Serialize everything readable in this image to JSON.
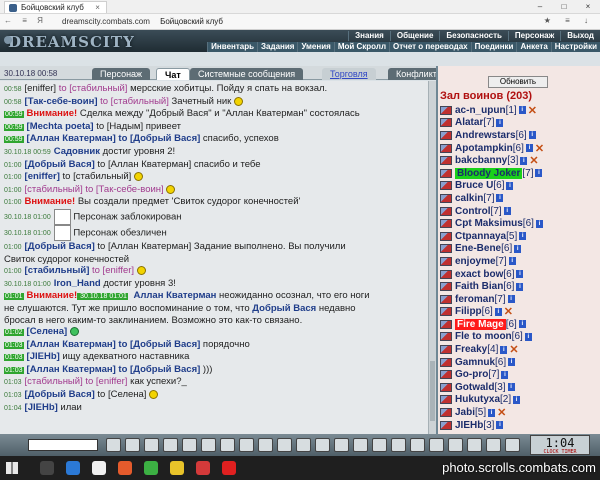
{
  "browser": {
    "tab_title": "Бойцовский клуб",
    "url": "dreamscity.combats.com",
    "page_title": "Бойцовский клуб",
    "nav_glyphs": "← ≡ Я",
    "tools_glyphs": "★ ≡ ↓"
  },
  "game": {
    "logo": "DREAMSCITY",
    "menu_top": [
      "Знания",
      "Общение",
      "Безопасность",
      "Персонаж",
      "Выход"
    ],
    "menu_bottom": [
      "Инвентарь",
      "Задания",
      "Умения",
      "Мой Скролл",
      "Отчет о переводах",
      "Поединки",
      "Анкета",
      "Настройки"
    ]
  },
  "chat": {
    "meta": "30.10.18 00:58",
    "tabs": [
      {
        "label": "Персонаж",
        "style": "plain"
      },
      {
        "label": "Чат",
        "style": "active"
      },
      {
        "label": "Системные сообщения",
        "style": "plain"
      },
      {
        "label": "Торговля",
        "style": "link"
      },
      {
        "label": "Конфликты",
        "style": "plain"
      }
    ],
    "lines": [
      [
        {
          "c": "t",
          "v": "00:58"
        },
        {
          "c": "",
          "v": "[eniffer] "
        },
        {
          "c": "st",
          "v": "to [стабильный]"
        },
        {
          "c": "",
          "v": " мерсские хобитцы. Пойду я спать на вокзал."
        }
      ],
      [
        {
          "c": "t",
          "v": "00:58"
        },
        {
          "c": "nk",
          "v": "[Так-себе-воин]"
        },
        {
          "c": "st",
          "v": " to [стабильный]"
        },
        {
          "c": "",
          "v": " Зачетный ник "
        },
        {
          "c": "sm",
          "v": ""
        }
      ],
      [
        {
          "c": "t hl",
          "v": "00:59"
        },
        {
          "c": "rd",
          "v": "Внимание!"
        },
        {
          "c": "",
          "v": " Сделка между \"Добрый Вася\" и \"Аллан Кватерман\" состоялась"
        }
      ],
      [
        {
          "c": "t hl",
          "v": "00:59"
        },
        {
          "c": "nk",
          "v": "[Mechta poeta]"
        },
        {
          "c": "",
          "v": " to [Надым] привеет"
        }
      ],
      [
        {
          "c": "t hl",
          "v": "00:59"
        },
        {
          "c": "nk",
          "v": "[Аллан Кватерман]"
        },
        {
          "c": "nk",
          "v": " to [Добрый Вася]"
        },
        {
          "c": "",
          "v": " спасибо, успехов"
        }
      ],
      [
        {
          "c": "t",
          "v": "30.10.18 00:59"
        },
        {
          "c": "nk",
          "v": "Садовник"
        },
        {
          "c": "",
          "v": " достиг уровня 2!"
        }
      ],
      [
        {
          "c": "t",
          "v": "01:00"
        },
        {
          "c": "nk",
          "v": "[Добрый Вася]"
        },
        {
          "c": "",
          "v": " to [Аллан Кватерман] спасибо и тебе"
        }
      ],
      [
        {
          "c": "t",
          "v": "01:00"
        },
        {
          "c": "nk",
          "v": "[eniffer]"
        },
        {
          "c": "",
          "v": " to [стабильный] "
        },
        {
          "c": "sm",
          "v": ""
        }
      ],
      [
        {
          "c": "t",
          "v": "01:00"
        },
        {
          "c": "st",
          "v": "[стабильный]"
        },
        {
          "c": "st",
          "v": " to [Так-себе-воин] "
        },
        {
          "c": "sm",
          "v": ""
        }
      ],
      [
        {
          "c": "t",
          "v": "01:00"
        },
        {
          "c": "rd",
          "v": "Внимание!"
        },
        {
          "c": "",
          "v": " Вы создали предмет 'Свиток судорог конечностей'"
        }
      ],
      [
        {
          "c": "t",
          "v": "30.10.18 01:00"
        },
        {
          "c": "img",
          "v": ""
        },
        {
          "c": "",
          "v": " Персонаж заблокирован"
        }
      ],
      [
        {
          "c": "t",
          "v": "30.10.18 01:00"
        },
        {
          "c": "img",
          "v": ""
        },
        {
          "c": "",
          "v": " Персонаж обезличен"
        }
      ],
      [
        {
          "c": "t",
          "v": "01:00"
        },
        {
          "c": "nk",
          "v": "[Добрый Вася]"
        },
        {
          "c": "",
          "v": " to [Аллан Кватерман] Задание выполнено. Вы получили"
        }
      ],
      [
        {
          "c": "",
          "v": "Свиток судорог конечностей"
        }
      ],
      [
        {
          "c": "t",
          "v": "01:00"
        },
        {
          "c": "nk",
          "v": "[стабильный]"
        },
        {
          "c": "st",
          "v": " to [eniffer] "
        },
        {
          "c": "sm",
          "v": ""
        }
      ],
      [
        {
          "c": "t",
          "v": "30.10.18 01:00"
        },
        {
          "c": "nk",
          "v": "Iron_Hand"
        },
        {
          "c": "",
          "v": " достиг уровня 3!"
        }
      ],
      [
        {
          "c": "t hl",
          "v": "01:01"
        },
        {
          "c": "rd",
          "v": "Внимание!"
        },
        {
          "c": "t hl",
          "v": " 30.10.18 01:01"
        },
        {
          "c": "nk",
          "v": " Аллан Кватерман"
        },
        {
          "c": "",
          "v": " неожиданно осознал, что его ноги"
        }
      ],
      [
        {
          "c": "",
          "v": "не слушаются. Тут же пришло воспоминание о том, что "
        },
        {
          "c": "nk",
          "v": "Добрый Вася"
        },
        {
          "c": "",
          "v": " недавно"
        }
      ],
      [
        {
          "c": "",
          "v": "бросал в него каким-то заклинанием. Возможно это как-то связано."
        }
      ],
      [
        {
          "c": "t hl",
          "v": "01:02"
        },
        {
          "c": "nk",
          "v": "[Селена]"
        },
        {
          "c": "",
          "v": " "
        },
        {
          "c": "sm g",
          "v": ""
        }
      ],
      [
        {
          "c": "t hl",
          "v": "01:03"
        },
        {
          "c": "nk",
          "v": "[Аллан Кватерман]"
        },
        {
          "c": "nk",
          "v": " to [Добрый Вася]"
        },
        {
          "c": "",
          "v": " порядочно"
        }
      ],
      [
        {
          "c": "t hl",
          "v": "01:03"
        },
        {
          "c": "nk",
          "v": "[JIEHb]"
        },
        {
          "c": "",
          "v": " ищу адекватного наставника"
        }
      ],
      [
        {
          "c": "t hl",
          "v": "01:03"
        },
        {
          "c": "nk",
          "v": "[Аллан Кватерман]"
        },
        {
          "c": "nk",
          "v": " to [Добрый Вася]"
        },
        {
          "c": "",
          "v": " )))"
        }
      ],
      [
        {
          "c": "t",
          "v": "01:03"
        },
        {
          "c": "st",
          "v": "[стабильный]"
        },
        {
          "c": "st",
          "v": " to [eniffer]"
        },
        {
          "c": "",
          "v": " как успехи?_"
        }
      ],
      [
        {
          "c": "t",
          "v": "01:03"
        },
        {
          "c": "nk",
          "v": "[Добрый Вася]"
        },
        {
          "c": "",
          "v": " to [Селена] "
        },
        {
          "c": "sm",
          "v": ""
        }
      ],
      [
        {
          "c": "t",
          "v": "01:04"
        },
        {
          "c": "nk",
          "v": "[JIEHb]"
        },
        {
          "c": "",
          "v": " илаи"
        }
      ]
    ]
  },
  "players": {
    "refresh_label": "Обновить",
    "hall_title": "Зал воинов (203)",
    "list": [
      {
        "name": "ac-n_upun",
        "level": "1",
        "x": true
      },
      {
        "name": "Alatar",
        "level": "7",
        "x": false
      },
      {
        "name": "Andrewstars",
        "level": "6",
        "x": false
      },
      {
        "name": "Apotampkin",
        "level": "6",
        "x": true
      },
      {
        "name": "bakcbanny",
        "level": "3",
        "x": true
      },
      {
        "name": "Bloody Joker",
        "level": "7",
        "x": false,
        "hl": "green"
      },
      {
        "name": "Bruce U",
        "level": "6",
        "x": false
      },
      {
        "name": "calkin",
        "level": "7",
        "x": false
      },
      {
        "name": "Control",
        "level": "7",
        "x": false
      },
      {
        "name": "Cpt Maksimus",
        "level": "6",
        "x": false
      },
      {
        "name": "Ctpannaya",
        "level": "5",
        "x": false
      },
      {
        "name": "Ene-Bene",
        "level": "6",
        "x": false
      },
      {
        "name": "enjoyme",
        "level": "7",
        "x": false
      },
      {
        "name": "exact bow",
        "level": "6",
        "x": false
      },
      {
        "name": "Faith Bian",
        "level": "6",
        "x": false
      },
      {
        "name": "feroman",
        "level": "7",
        "x": false
      },
      {
        "name": "Filipp",
        "level": "6",
        "x": true
      },
      {
        "name": "Fire Mage",
        "level": "6",
        "x": false,
        "hl": "red"
      },
      {
        "name": "Fle to moon",
        "level": "6",
        "x": false
      },
      {
        "name": "Freaky",
        "level": "4",
        "x": true
      },
      {
        "name": "Gamnuk",
        "level": "6",
        "x": false
      },
      {
        "name": "Go-pro",
        "level": "7",
        "x": false
      },
      {
        "name": "Gotwald",
        "level": "3",
        "x": false
      },
      {
        "name": "Hukutyxa",
        "level": "2",
        "x": false
      },
      {
        "name": "Jabi",
        "level": "5",
        "x": true
      },
      {
        "name": "JIEHb",
        "level": "3",
        "x": false
      }
    ]
  },
  "clock": {
    "time": "1:04",
    "labels": "CLOCK TIMER"
  },
  "taskbar": {
    "watermark": "photo.scrolls.combats.com"
  }
}
